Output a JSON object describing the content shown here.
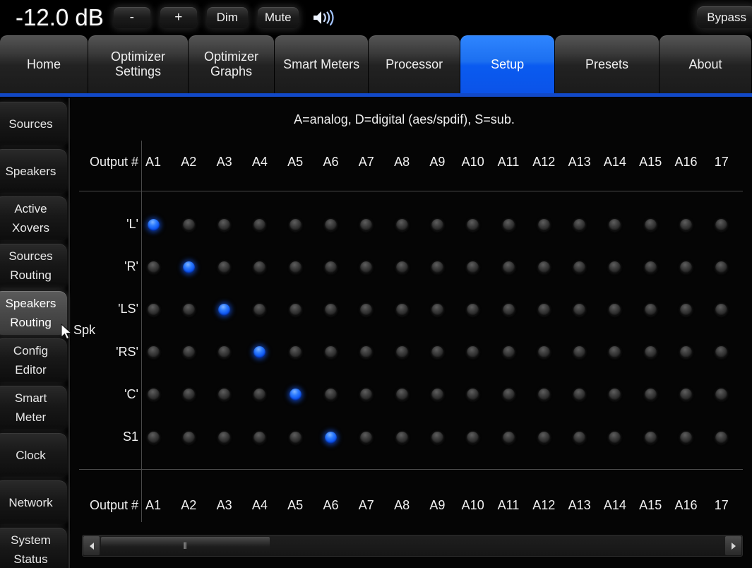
{
  "header": {
    "db_readout": "-12.0 dB",
    "minus_label": "-",
    "plus_label": "+",
    "dim_label": "Dim",
    "mute_label": "Mute",
    "speaker_icon": "speaker-volume-icon",
    "bypass_label": "Bypass"
  },
  "tabs": [
    {
      "label": "Home",
      "active": false
    },
    {
      "label": "Optimizer\nSettings",
      "active": false
    },
    {
      "label": "Optimizer\nGraphs",
      "active": false
    },
    {
      "label": "Smart\nMeters",
      "active": false
    },
    {
      "label": "Processor",
      "active": false
    },
    {
      "label": "Setup",
      "active": true
    },
    {
      "label": "Presets",
      "active": false
    },
    {
      "label": "About",
      "active": false
    }
  ],
  "sidebar": {
    "items": [
      {
        "label": "Sources",
        "selected": false
      },
      {
        "label": "Speakers",
        "selected": false
      },
      {
        "label": "Active\nXovers",
        "selected": false
      },
      {
        "label": "Sources\nRouting",
        "selected": false
      },
      {
        "label": "Speakers\nRouting",
        "selected": true
      },
      {
        "label": "Config\nEditor",
        "selected": false
      },
      {
        "label": "Smart\nMeter",
        "selected": false
      },
      {
        "label": "Clock",
        "selected": false
      },
      {
        "label": "Network",
        "selected": false
      },
      {
        "label": "System\nStatus",
        "selected": false
      }
    ]
  },
  "main": {
    "legend": "A=analog, D=digital (aes/spdif), S=sub.",
    "output_header_label": "Output #",
    "group_label": "Spk",
    "columns": [
      "A1",
      "A2",
      "A3",
      "A4",
      "A5",
      "A6",
      "A7",
      "A8",
      "A9",
      "A10",
      "A11",
      "A12",
      "A13",
      "A14",
      "A15",
      "A16",
      "17"
    ],
    "rows": [
      "'L'",
      "'R'",
      "'LS'",
      "'RS'",
      "'C'",
      "S1"
    ],
    "matrix": [
      [
        1,
        0,
        0,
        0,
        0,
        0,
        0,
        0,
        0,
        0,
        0,
        0,
        0,
        0,
        0,
        0,
        0
      ],
      [
        0,
        1,
        0,
        0,
        0,
        0,
        0,
        0,
        0,
        0,
        0,
        0,
        0,
        0,
        0,
        0,
        0
      ],
      [
        0,
        0,
        1,
        0,
        0,
        0,
        0,
        0,
        0,
        0,
        0,
        0,
        0,
        0,
        0,
        0,
        0
      ],
      [
        0,
        0,
        0,
        1,
        0,
        0,
        0,
        0,
        0,
        0,
        0,
        0,
        0,
        0,
        0,
        0,
        0
      ],
      [
        0,
        0,
        0,
        0,
        1,
        0,
        0,
        0,
        0,
        0,
        0,
        0,
        0,
        0,
        0,
        0,
        0
      ],
      [
        0,
        0,
        0,
        0,
        0,
        1,
        0,
        0,
        0,
        0,
        0,
        0,
        0,
        0,
        0,
        0,
        0
      ]
    ],
    "accent_color": "#0b52f0",
    "active_dot_color": "#2f7dff",
    "inactive_dot_color": "#3c3c3c"
  },
  "scrollbar": {
    "left_arrow_icon": "caret-left-icon",
    "right_arrow_icon": "caret-right-icon",
    "thumb_grip_icon": "grip-icon",
    "thumb_grip_label": "‖",
    "thumb_position_percent": 0,
    "thumb_width_percent": 27
  }
}
